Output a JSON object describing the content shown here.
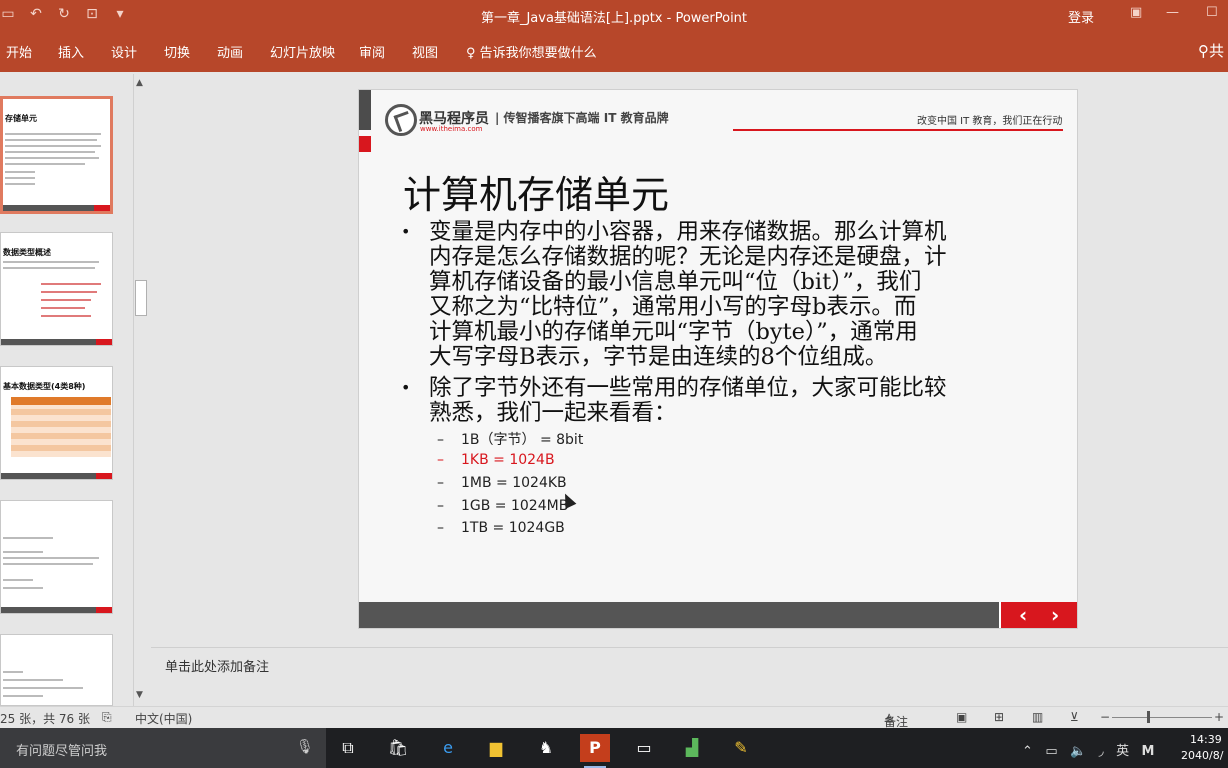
{
  "window": {
    "title": "第一章_Java基础语法[上].pptx  -  PowerPoint",
    "login_label": "登录"
  },
  "ribbon": {
    "tabs": [
      "开始",
      "插入",
      "设计",
      "切换",
      "动画",
      "幻灯片放映",
      "审阅",
      "视图"
    ],
    "tell_me": "告诉我你想要做什么",
    "share_label": "共"
  },
  "thumbnails": [
    {
      "title": "存储单元",
      "active": true
    },
    {
      "title": "数据类型概述",
      "active": false
    },
    {
      "title": "基本数据类型(4类8种)",
      "active": false
    },
    {
      "title": "",
      "active": false
    },
    {
      "title": "",
      "active": false
    }
  ],
  "slide": {
    "brand_name": "黑马程序员",
    "brand_url": "www.itheima.com",
    "brand_tagline": "| 传智播客旗下高端 IT 教育品牌",
    "header_slogan": "改变中国 IT 教育，我们正在行动",
    "title": "计算机存储单元",
    "bullet1_lines": [
      "变量是内存中的小容器，用来存储数据。那么计算机",
      "内存是怎么存储数据的呢？无论是内存还是硬盘，计",
      "算机存储设备的最小信息单元叫“位（bit）”，我们",
      "又称之为“比特位”，通常用小写的字母b表示。而",
      "计算机最小的存储单元叫“字节（byte）”，通常用",
      "大写字母B表示，字节是由连续的8个位组成。"
    ],
    "bullet2_lines": [
      "除了字节外还有一些常用的存储单位，大家可能比较",
      "熟悉，我们一起来看看："
    ],
    "sub_items": [
      {
        "text": "1B（字节） = 8bit",
        "highlight": false
      },
      {
        "text": "1KB = 1024B",
        "highlight": true
      },
      {
        "text": "1MB = 1024KB",
        "highlight": false
      },
      {
        "text": "1GB = 1024MB",
        "highlight": false
      },
      {
        "text": "1TB = 1024GB",
        "highlight": false
      }
    ],
    "nav_prev": "‹",
    "nav_next": "›"
  },
  "notes_placeholder": "单击此处添加备注",
  "status": {
    "slide_counter": "25 张，共 76 张",
    "language": "中文(中国)",
    "notes_label": "备注"
  },
  "taskbar": {
    "search_placeholder": "有问题尽管问我",
    "ime_label": "英",
    "ime_mode": "M",
    "time": "14:39",
    "date": "2040/8/"
  },
  "colors": {
    "ribbon": "#b7472a",
    "accent_red": "#d8171e",
    "footer_bar": "#555555"
  }
}
